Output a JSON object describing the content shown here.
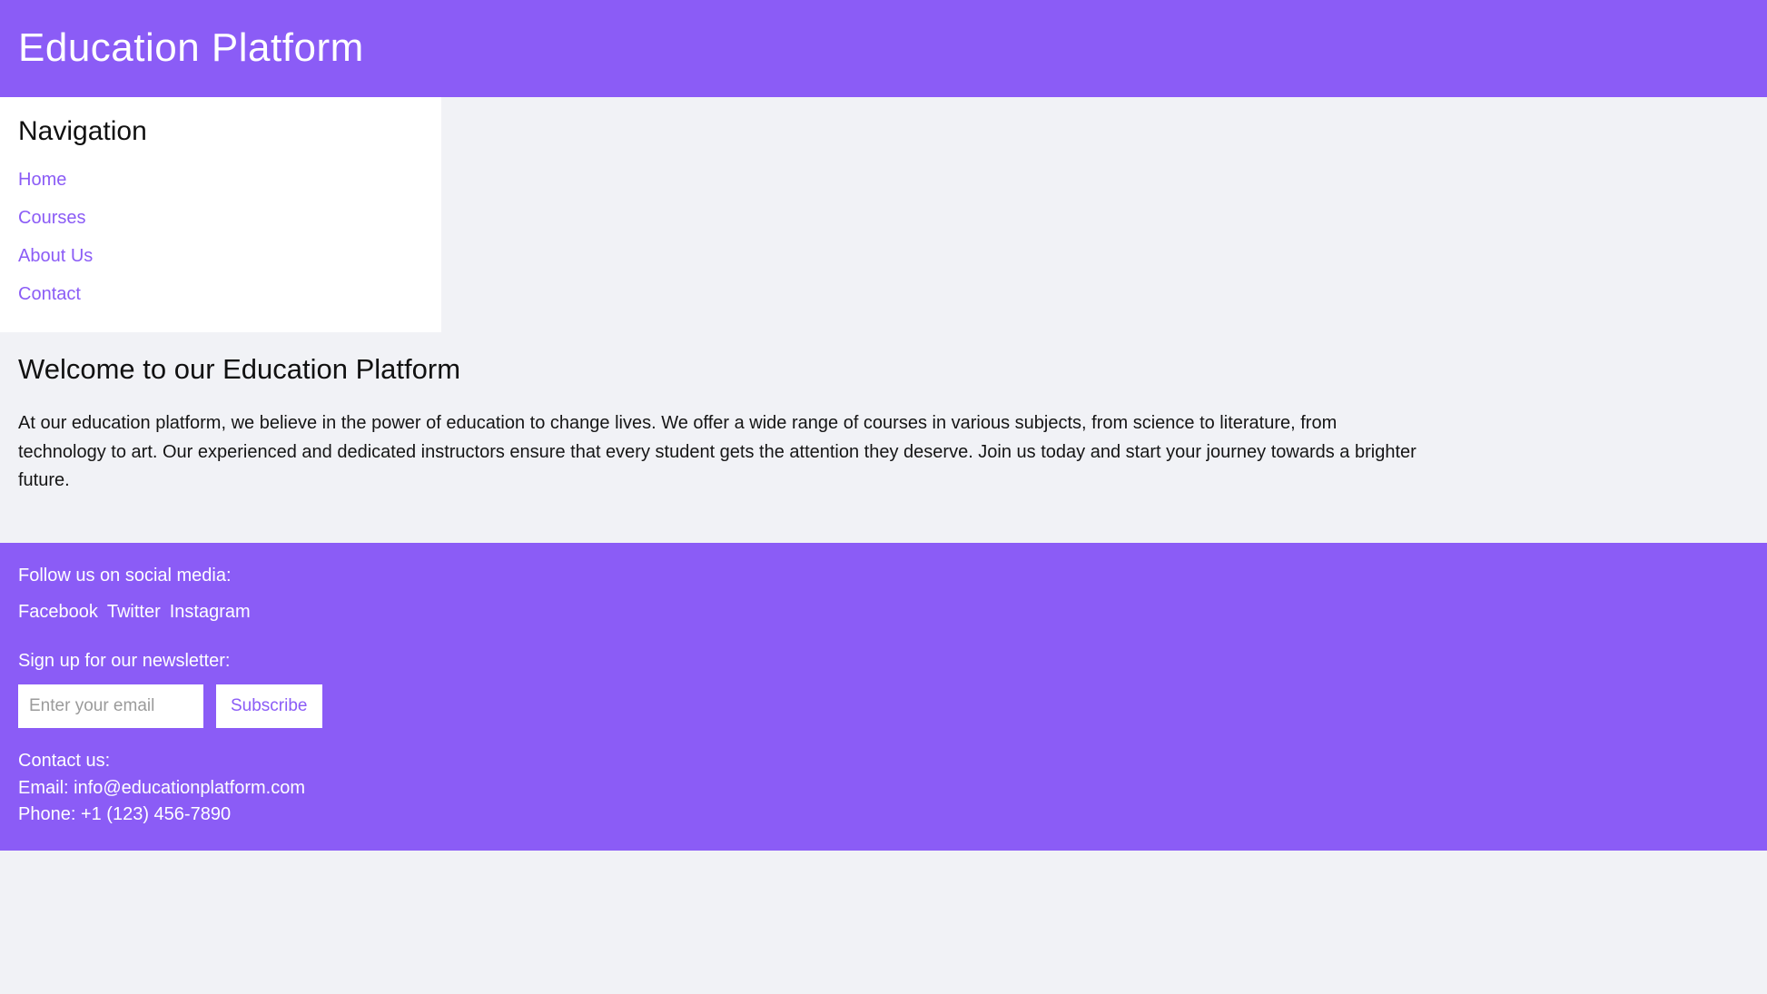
{
  "theme": {
    "brand_purple": "#8b5cf6",
    "page_background": "#f1f2f6",
    "panel_background": "#ffffff",
    "text_color": "#111111"
  },
  "header": {
    "title": "Education Platform"
  },
  "sidebar": {
    "title": "Navigation",
    "items": [
      {
        "label": "Home"
      },
      {
        "label": "Courses"
      },
      {
        "label": "About Us"
      },
      {
        "label": "Contact"
      }
    ]
  },
  "main": {
    "title": "Welcome to our Education Platform",
    "paragraph": "At our education platform, we believe in the power of education to change lives. We offer a wide range of courses in various subjects, from science to literature, from technology to art. Our experienced and dedicated instructors ensure that every student gets the attention they deserve. Join us today and start your journey towards a brighter future."
  },
  "footer": {
    "social_label": "Follow us on social media:",
    "social_links": [
      {
        "label": "Facebook"
      },
      {
        "label": "Twitter"
      },
      {
        "label": "Instagram"
      }
    ],
    "newsletter_label": "Sign up for our newsletter:",
    "email_placeholder": "Enter your email",
    "email_value": "",
    "subscribe_label": "Subscribe",
    "contact_heading": "Contact us:",
    "contact_email": "Email: info@educationplatform.com",
    "contact_phone": "Phone: +1 (123) 456-7890"
  }
}
